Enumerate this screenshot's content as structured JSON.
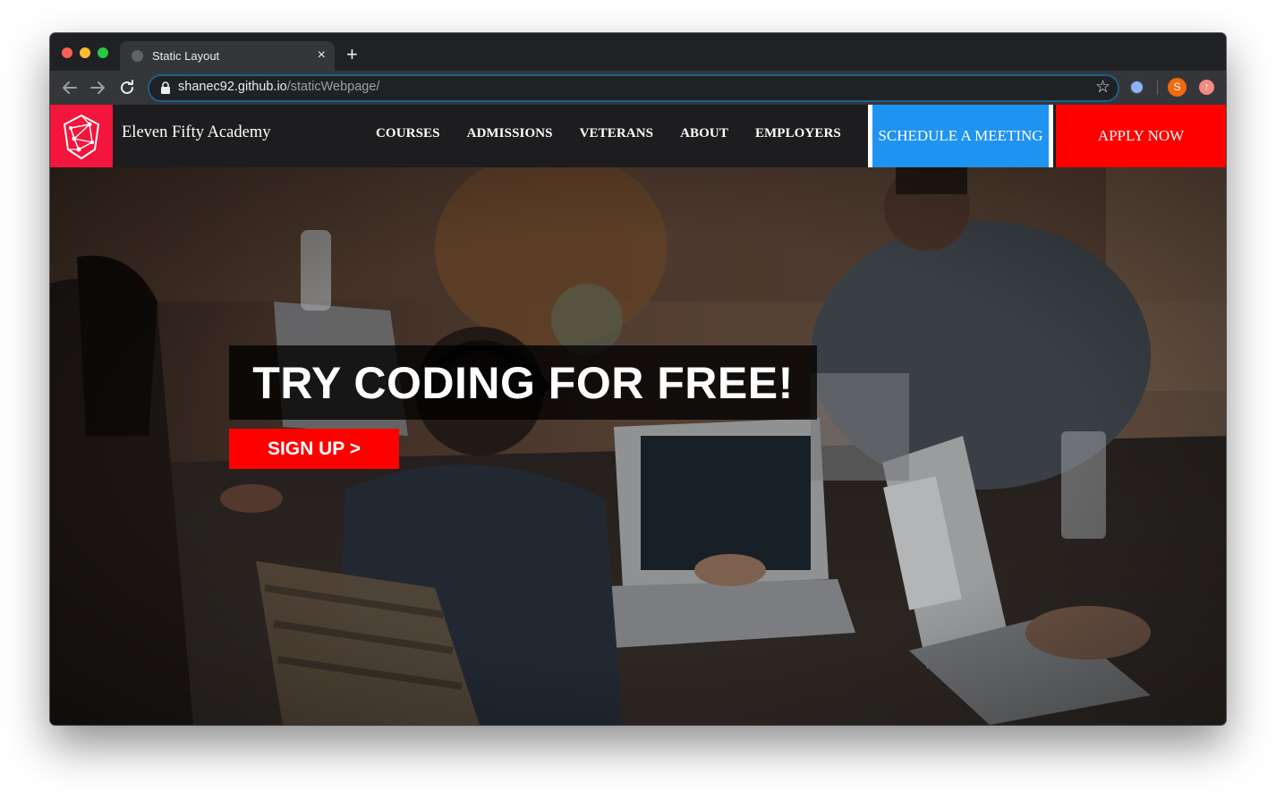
{
  "browser": {
    "tab_title": "Static Layout",
    "tab_close": "×",
    "new_tab": "+",
    "url_host": "shanec92.github.io",
    "url_path": "/staticWebpage/",
    "profile_initial": "S"
  },
  "site": {
    "brand": "Eleven Fifty Academy",
    "nav": [
      "COURSES",
      "ADMISSIONS",
      "VETERANS",
      "ABOUT",
      "EMPLOYERS"
    ],
    "cta_meeting": "SCHEDULE A MEETING",
    "cta_apply": "APPLY NOW",
    "accent_colors": {
      "logo": "#f3153b",
      "meeting": "#1f93f0",
      "apply": "#ff0000"
    }
  },
  "hero": {
    "headline": "TRY CODING FOR FREE!",
    "signup": "SIGN UP >"
  },
  "icons": [
    "back-arrow-icon",
    "forward-arrow-icon",
    "reload-icon",
    "lock-icon",
    "star-icon",
    "extension-icon",
    "update-icon",
    "logo-icon"
  ]
}
